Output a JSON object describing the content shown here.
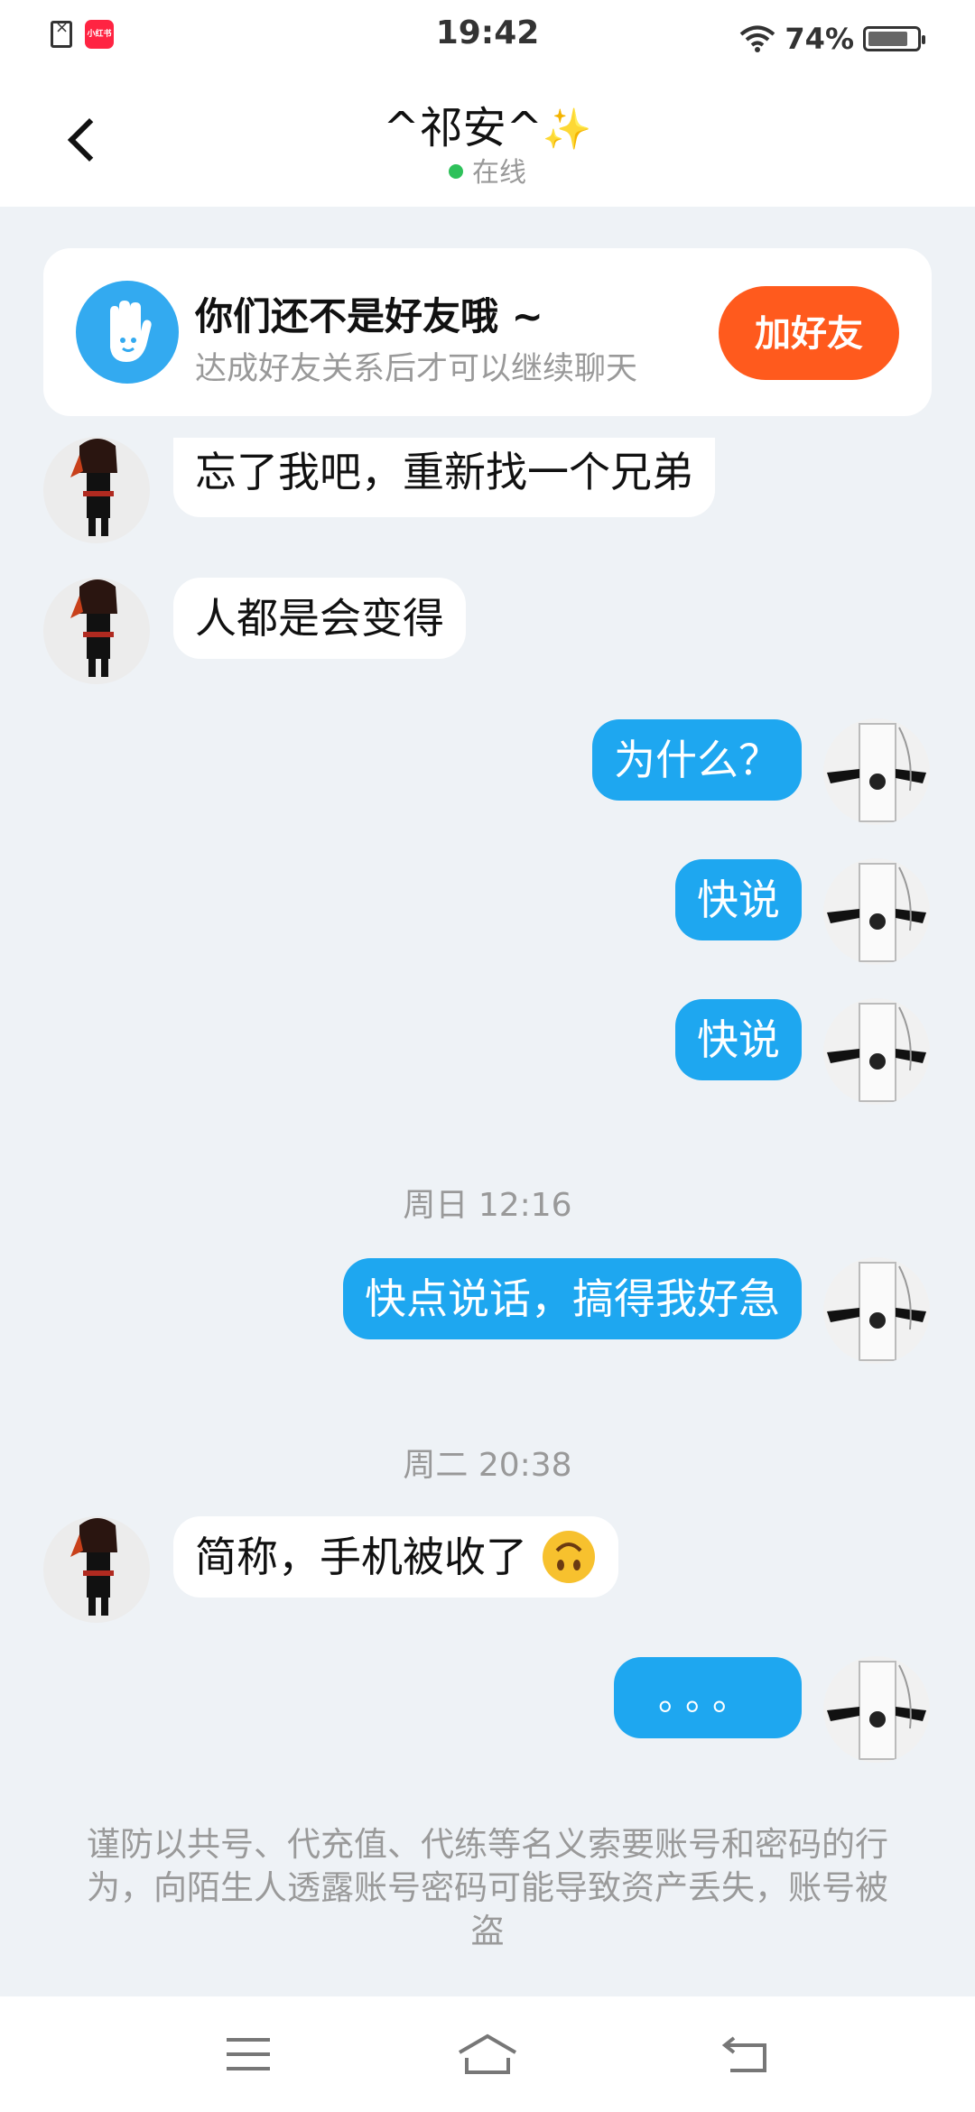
{
  "status_bar": {
    "time": "19:42",
    "app_badge": "小红书",
    "battery": "74%",
    "icons": [
      "file-x-icon",
      "wifi-icon",
      "battery-icon"
    ]
  },
  "header": {
    "title": "^祁安^",
    "title_emoji": "✨",
    "status": "在线",
    "status_color": "#2ec15a"
  },
  "friend_prompt": {
    "title": "你们还不是好友哦 ~",
    "subtitle": "达成好友关系后才可以继续聊天",
    "button": "加好友",
    "button_color": "#ff5a1d"
  },
  "messages": [
    {
      "from": "them",
      "text": "忘了我吧，重新找一个兄弟"
    },
    {
      "from": "them",
      "text": "人都是会变得"
    },
    {
      "from": "me",
      "text": "为什么？"
    },
    {
      "from": "me",
      "text": "快说"
    },
    {
      "from": "me",
      "text": "快说"
    },
    {
      "type": "time",
      "text": "周日 12:16"
    },
    {
      "from": "me",
      "text": "快点说话，搞得我好急"
    },
    {
      "type": "time",
      "text": "周二 20:38"
    },
    {
      "from": "them",
      "text": "简称，手机被收了",
      "emoji": "upside-down-face-icon"
    },
    {
      "from": "me",
      "text": "。。。"
    }
  ],
  "warning": "谨防以共号、代充值、代练等名义索要账号和密码的行为，向陌生人透露账号密码可能导致资产丢失，账号被盗",
  "colors": {
    "outgoing_bubble": "#1ea7f0",
    "incoming_bubble": "#ffffff",
    "background": "#eef2f6"
  },
  "nav": [
    "menu-icon",
    "home-icon",
    "back-icon"
  ]
}
